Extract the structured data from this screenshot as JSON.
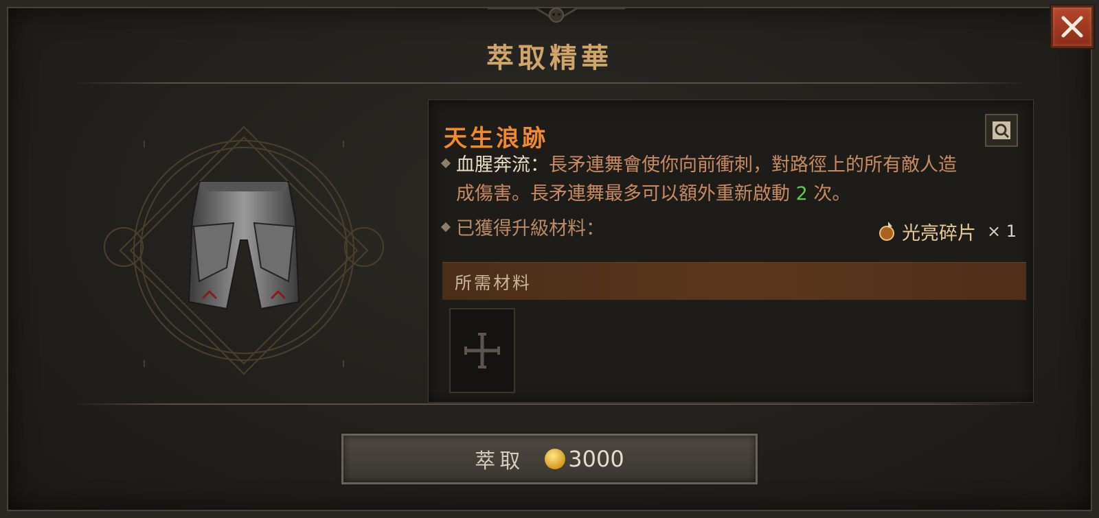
{
  "window": {
    "title": "萃取精華"
  },
  "item": {
    "name": "天生浪跡",
    "aspect_name": "血腥奔流",
    "aspect_sep": "：",
    "desc_line1": "長矛連舞會使你向前衝刺，對路徑上的所有敵人造",
    "desc_line2_a": "成傷害。長矛連舞最多可以額外重新啟動 ",
    "desc_value": "2",
    "desc_line2_b": " 次。",
    "materials_label": "已獲得升級材料：",
    "material_name": "光亮碎片",
    "material_count": "× 1"
  },
  "required": {
    "label": "所需材料"
  },
  "action": {
    "label": "萃取",
    "cost": "3000"
  },
  "icons": [
    "close-icon",
    "inspect-icon",
    "shard-icon",
    "add-slot-icon",
    "gold-coin-icon",
    "pants-item-icon",
    "sigil-circle"
  ],
  "colors": {
    "title": "#cfa56a",
    "item_name": "#f08a2c",
    "desc": "#c88a62",
    "value": "#5fcf3f",
    "close": "#b5472c"
  }
}
